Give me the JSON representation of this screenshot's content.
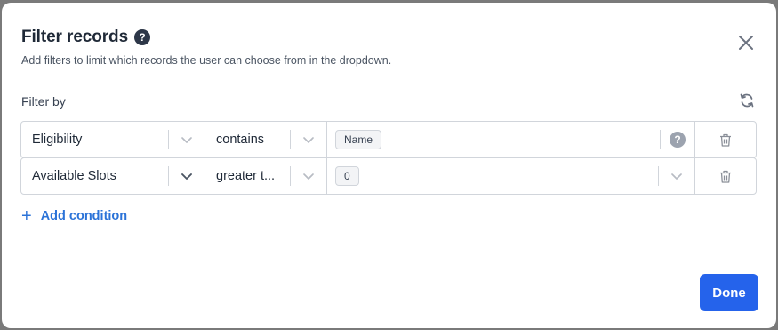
{
  "dialog": {
    "title": "Filter records",
    "help_icon": "question-circle-icon",
    "subtitle": "Add filters to limit which records the user can choose from in the dropdown.",
    "close_icon": "close-icon"
  },
  "filter": {
    "label": "Filter by",
    "reset_icon": "refresh-icon",
    "rows": [
      {
        "field": "Eligibility",
        "operator": "contains",
        "value_tag": "Name"
      },
      {
        "field": "Available Slots",
        "operator": "greater t...",
        "value_tag": "0"
      }
    ],
    "add_condition_label": "Add condition"
  },
  "footer": {
    "done_label": "Done"
  },
  "colors": {
    "accent": "#2563eb",
    "link": "#2b73d8"
  }
}
